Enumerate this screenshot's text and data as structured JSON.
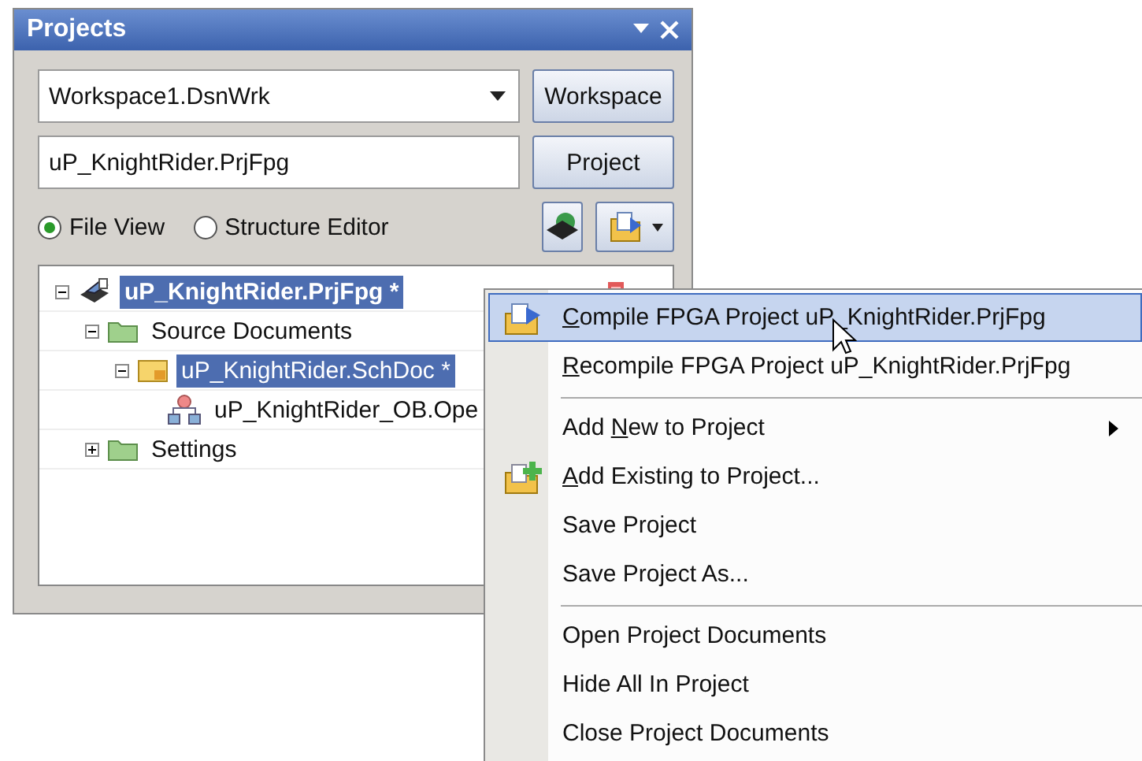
{
  "panel": {
    "title": "Projects",
    "workspace_combo": {
      "value": "Workspace1.DsnWrk"
    },
    "workspace_button": "Workspace",
    "project_field": {
      "value": "uP_KnightRider.PrjFpg"
    },
    "project_button": "Project",
    "view_options": [
      {
        "label": "File View",
        "selected": true
      },
      {
        "label": "Structure Editor",
        "selected": false
      }
    ],
    "tree": [
      {
        "kind": "project",
        "label": "uP_KnightRider.PrjFpg *",
        "selected": true,
        "expanded": true,
        "children": [
          {
            "kind": "folder",
            "label": "Source Documents",
            "selected": false,
            "expanded": true,
            "children": [
              {
                "kind": "schematic",
                "label": "uP_KnightRider.SchDoc *",
                "selected": true,
                "expanded": true,
                "children": [
                  {
                    "kind": "core",
                    "label": "uP_KnightRider_OB.Ope",
                    "selected": false
                  }
                ]
              }
            ]
          },
          {
            "kind": "folder",
            "label": "Settings",
            "selected": false,
            "expanded": false
          }
        ]
      }
    ]
  },
  "context_menu": {
    "items": [
      {
        "kind": "item",
        "label": "Compile FPGA Project uP_KnightRider.PrjFpg",
        "highlighted": true,
        "submenu": false
      },
      {
        "kind": "item",
        "label": "Recompile FPGA Project uP_KnightRider.PrjFpg",
        "highlighted": false,
        "submenu": false
      },
      {
        "kind": "separator"
      },
      {
        "kind": "item",
        "label": "Add New to Project",
        "highlighted": false,
        "submenu": true
      },
      {
        "kind": "item",
        "label": "Add Existing to Project...",
        "highlighted": false,
        "submenu": false
      },
      {
        "kind": "item",
        "label": "Save Project",
        "highlighted": false,
        "submenu": false
      },
      {
        "kind": "item",
        "label": "Save Project As...",
        "highlighted": false,
        "submenu": false
      },
      {
        "kind": "separator"
      },
      {
        "kind": "item",
        "label": "Open Project Documents",
        "highlighted": false,
        "submenu": false
      },
      {
        "kind": "item",
        "label": "Hide All In Project",
        "highlighted": false,
        "submenu": false
      },
      {
        "kind": "item",
        "label": "Close Project Documents",
        "highlighted": false,
        "submenu": false
      }
    ]
  }
}
